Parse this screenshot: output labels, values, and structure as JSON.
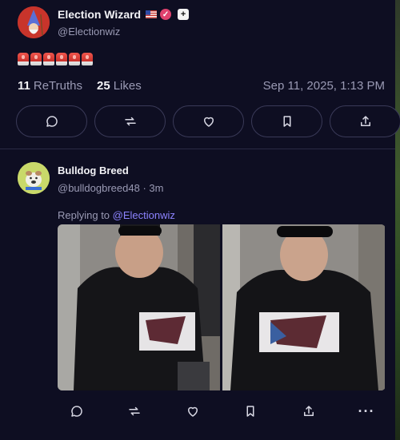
{
  "post": {
    "author_name": "Election Wizard",
    "author_handle": "@Electionwiz",
    "siren_count": 6,
    "retruths_count": "11",
    "retruths_label": "ReTruths",
    "likes_count": "25",
    "likes_label": "Likes",
    "timestamp": "Sep 11, 2025, 1:13 PM",
    "actions": [
      "reply-icon",
      "retruth-icon",
      "like-icon",
      "bookmark-icon",
      "share-icon"
    ]
  },
  "reply": {
    "author_name": "Bulldog Breed",
    "author_handle": "@bulldogbreed48 · 3m",
    "replying_prefix": "Replying to",
    "replying_to": "@Electionwiz",
    "image_count": 2,
    "actions": [
      "reply-icon",
      "retruth-icon",
      "like-icon",
      "bookmark-icon",
      "share-icon",
      "more-icon"
    ],
    "more_label": "···"
  },
  "colors": {
    "background": "#0e0e22",
    "accent_link": "#8c83ff",
    "verified_badge": "#e0426e",
    "muted_text": "#9a9ab4"
  }
}
